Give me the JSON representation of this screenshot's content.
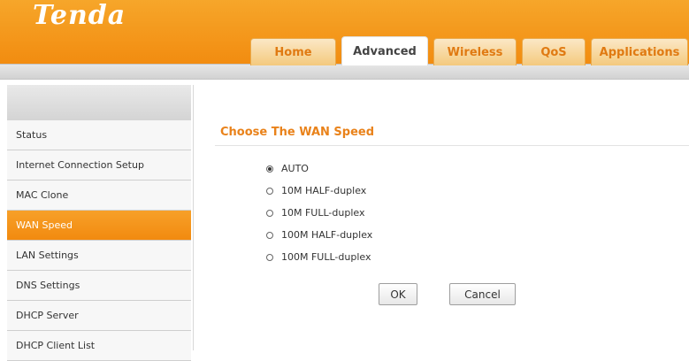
{
  "brand": {
    "logo": "Tenda"
  },
  "nav": {
    "tabs": [
      {
        "label": "Home"
      },
      {
        "label": "Advanced",
        "active": true
      },
      {
        "label": "Wireless"
      },
      {
        "label": "QoS"
      },
      {
        "label": "Applications"
      }
    ]
  },
  "sidebar": {
    "items": [
      {
        "label": "Status"
      },
      {
        "label": "Internet Connection Setup"
      },
      {
        "label": "MAC Clone"
      },
      {
        "label": "WAN Speed",
        "active": true
      },
      {
        "label": "LAN Settings"
      },
      {
        "label": "DNS Settings"
      },
      {
        "label": "DHCP Server"
      },
      {
        "label": "DHCP Client List"
      }
    ]
  },
  "main": {
    "title": "Choose The WAN Speed",
    "options": [
      {
        "label": "AUTO",
        "checked": true
      },
      {
        "label": "10M HALF-duplex",
        "checked": false
      },
      {
        "label": "10M FULL-duplex",
        "checked": false
      },
      {
        "label": "100M HALF-duplex",
        "checked": false
      },
      {
        "label": "100M FULL-duplex",
        "checked": false
      }
    ],
    "ok_label": "OK",
    "cancel_label": "Cancel"
  },
  "colors": {
    "accent": "#f28c10",
    "title": "#e9821a"
  }
}
